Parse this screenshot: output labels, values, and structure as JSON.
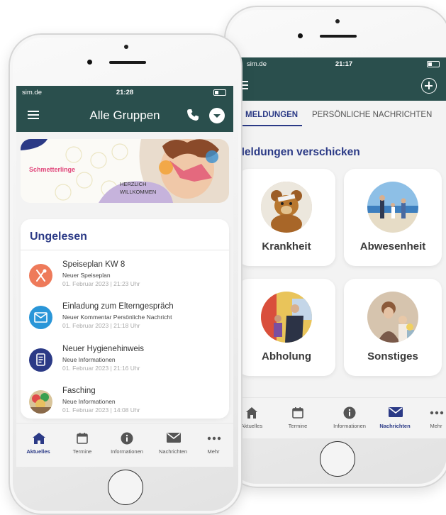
{
  "back_phone": {
    "status": {
      "carrier": "sim.de",
      "time": "21:17"
    },
    "tabs": [
      {
        "label": "MELDUNGEN",
        "active": true
      },
      {
        "label": "PERSÖNLICHE NACHRICHTEN",
        "active": false
      }
    ],
    "section_title": "Meldungen verschicken",
    "cards": [
      {
        "label": "Krankheit",
        "icon": "teddy-bear-photo"
      },
      {
        "label": "Abwesenheit",
        "icon": "beach-family-photo"
      },
      {
        "label": "Abholung",
        "icon": "pickup-photo"
      },
      {
        "label": "Sonstiges",
        "icon": "children-photo"
      }
    ],
    "nav": [
      {
        "label": "Aktuelles",
        "icon": "home-icon",
        "active": false
      },
      {
        "label": "Termine",
        "icon": "calendar-icon",
        "active": false
      },
      {
        "label": "Informationen",
        "icon": "info-icon",
        "active": false
      },
      {
        "label": "Nachrichten",
        "icon": "mail-icon",
        "active": true
      },
      {
        "label": "Mehr",
        "icon": "more-icon",
        "active": false
      }
    ]
  },
  "front_phone": {
    "status": {
      "carrier": "sim.de",
      "time": "21:28"
    },
    "title": "Alle Gruppen",
    "banner": {
      "logo": "Schmetterlinge",
      "greeting_line1": "HERZLICH",
      "greeting_line2": "WILLKOMMEN"
    },
    "unread": {
      "title": "Ungelesen",
      "items": [
        {
          "title": "Speiseplan KW 8",
          "subtitle": "Neuer Speiseplan",
          "date": "01. Februar 2023 | 21:23 Uhr",
          "icon": "fork-knife-icon",
          "color": "#ee7a5a"
        },
        {
          "title": "Einladung zum Elterngespräch",
          "subtitle": "Neuer Kommentar Persönliche Nachricht",
          "date": "01. Februar 2023 | 21:18 Uhr",
          "icon": "envelope-icon",
          "color": "#2a96d8"
        },
        {
          "title": "Neuer Hygienehinweis",
          "subtitle": "Neue Informationen",
          "date": "01. Februar 2023 | 21:16 Uhr",
          "icon": "document-icon",
          "color": "#2b3a86"
        },
        {
          "title": "Fasching",
          "subtitle": "Neue Informationen",
          "date": "01. Februar 2023 | 14:08 Uhr",
          "icon": "carnival-photo",
          "color": "#d8a040"
        }
      ]
    },
    "nav": [
      {
        "label": "Aktuelles",
        "icon": "home-icon",
        "active": true
      },
      {
        "label": "Termine",
        "icon": "calendar-icon",
        "active": false
      },
      {
        "label": "Informationen",
        "icon": "info-icon",
        "active": false
      },
      {
        "label": "Nachrichten",
        "icon": "mail-icon",
        "active": false
      },
      {
        "label": "Mehr",
        "icon": "more-icon",
        "active": false
      }
    ]
  },
  "colors": {
    "header": "#2a4f4d",
    "accent": "#2b3a86"
  }
}
